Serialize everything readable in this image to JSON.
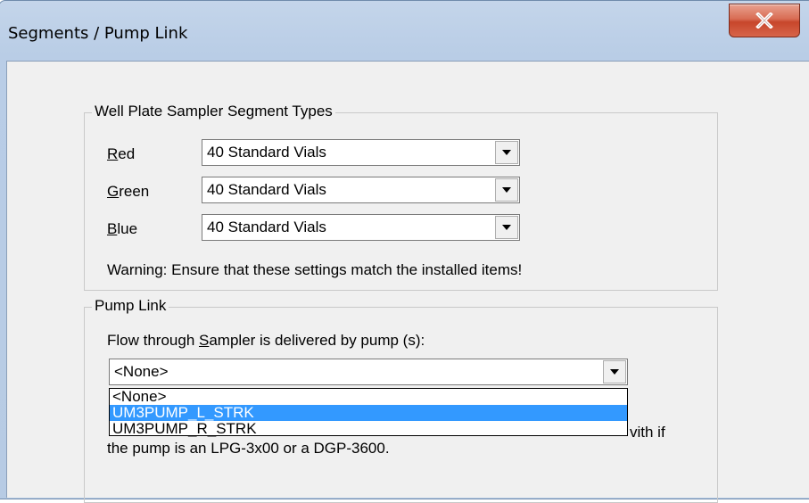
{
  "window": {
    "title": "Segments / Pump Link",
    "close_glyph": "X"
  },
  "segments": {
    "group_title": "Well Plate Sampler Segment Types",
    "rows": [
      {
        "label_accel": "R",
        "label_rest": "ed",
        "value": "40 Standard Vials"
      },
      {
        "label_accel": "G",
        "label_rest": "reen",
        "value": "40 Standard Vials"
      },
      {
        "label_accel": "B",
        "label_rest": "lue",
        "value": "40 Standard Vials"
      }
    ],
    "warning": "Warning: Ensure that these settings match the installed items!"
  },
  "pump_link": {
    "group_title": "Pump Link",
    "prompt_pre": "Flow through ",
    "prompt_accel": "S",
    "prompt_post": "ampler is delivered by pump (s):",
    "selected": "<None>",
    "options": [
      "<None>",
      "UM3PUMP_L_STRK",
      "UM3PUMP_R_STRK"
    ],
    "highlighted_option": "UM3PUMP_L_STRK",
    "hidden_text_tail": "vith if",
    "hidden_text_line2": "the pump is an LPG-3x00 or a DGP-3600."
  },
  "colors": {
    "highlight": "#3399ff",
    "close_button": "#c7462b"
  }
}
